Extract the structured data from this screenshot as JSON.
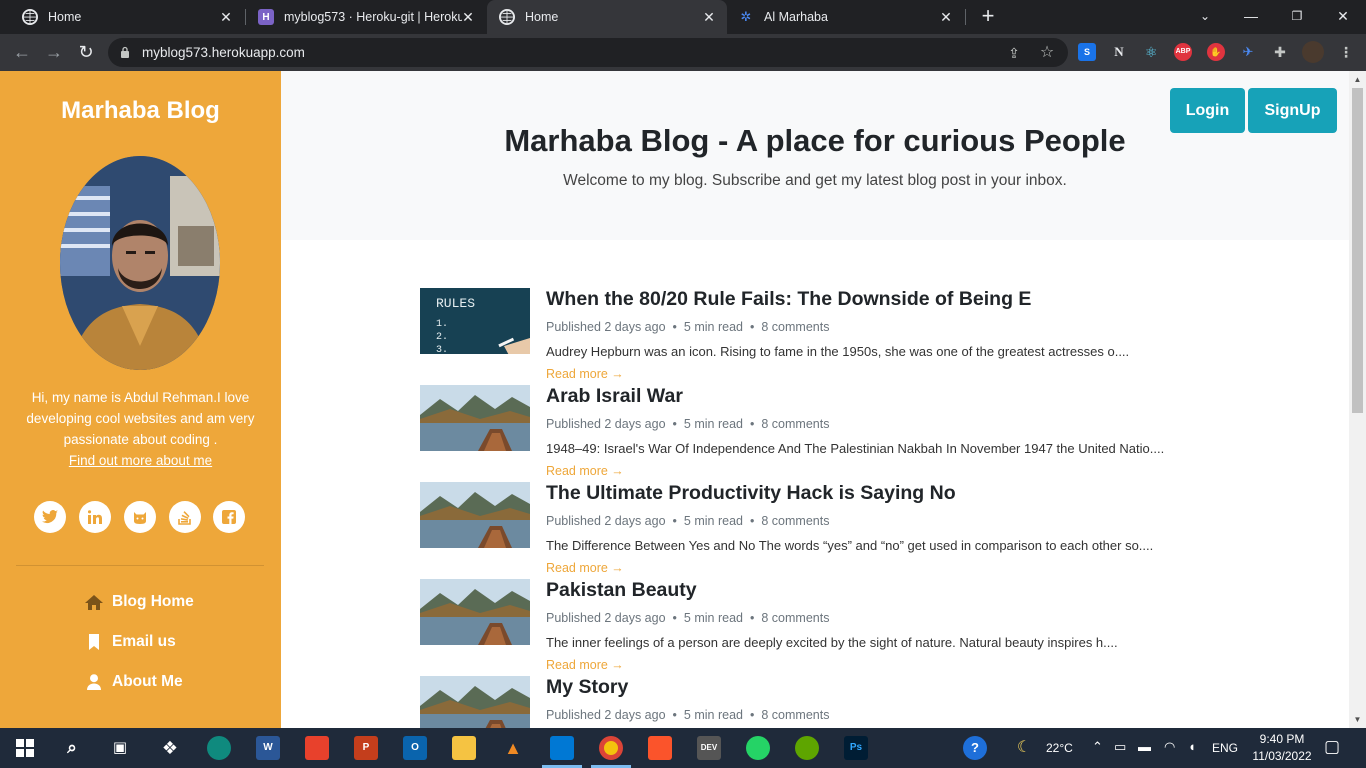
{
  "browser": {
    "tabs": [
      {
        "title": "Home"
      },
      {
        "title": "myblog573 · Heroku-git | Heroku"
      },
      {
        "title": "Home"
      },
      {
        "title": "Al Marhaba"
      }
    ],
    "url": "myblog573.herokuapp.com",
    "extensions": [
      "S",
      "N",
      "ABP"
    ]
  },
  "sidebar": {
    "brand": "Marhaba Blog",
    "intro": "Hi, my name is Abdul Rehman.I love developing cool websites and am very passionate about coding .",
    "find_more": "Find out more about me",
    "social_icons": [
      "twitter-icon",
      "linkedin-icon",
      "github-icon",
      "stackoverflow-icon",
      "facebook-icon"
    ],
    "nav": [
      {
        "label": "Blog Home",
        "icon": "home-icon"
      },
      {
        "label": "Email us",
        "icon": "bookmark-icon"
      },
      {
        "label": "About Me",
        "icon": "user-icon"
      }
    ]
  },
  "hero": {
    "title": "Marhaba Blog - A place for curious People",
    "subtitle": "Welcome to my blog. Subscribe and get my latest blog post in your inbox.",
    "login": "Login",
    "signup": "SignUp"
  },
  "posts": [
    {
      "title": "When the 80/20 Rule Fails: The Downside of Being E",
      "published": "Published 2 days ago",
      "read": "5 min read",
      "comments": "8 comments",
      "excerpt": "Audrey Hepburn was an icon. Rising to fame in the 1950s, she was one of the greatest actresses o....",
      "read_more": "Read more →",
      "thumb_text": "RULES"
    },
    {
      "title": "Arab Israil War",
      "published": "Published 2 days ago",
      "read": "5 min read",
      "comments": "8 comments",
      "excerpt": "1948–49: Israel's War Of Independence And The Palestinian Nakbah In November 1947 the United Natio....",
      "read_more": "Read more →"
    },
    {
      "title": "The Ultimate Productivity Hack is Saying No",
      "published": "Published 2 days ago",
      "read": "5 min read",
      "comments": "8 comments",
      "excerpt": "The Difference Between Yes and No The words “yes” and “no” get used in comparison to each other so....",
      "read_more": "Read more →"
    },
    {
      "title": "Pakistan Beauty",
      "published": "Published 2 days ago",
      "read": "5 min read",
      "comments": "8 comments",
      "excerpt": "The inner feelings of a person are deeply excited by the sight of nature. Natural beauty inspires h....",
      "read_more": "Read more →"
    },
    {
      "title": "My Story",
      "published": "Published 2 days ago",
      "read": "5 min read",
      "comments": "8 comments",
      "excerpt": "",
      "read_more": ""
    }
  ],
  "taskbar": {
    "weather": "22°C",
    "lang": "ENG",
    "time": "9:40 PM",
    "date": "11/03/2022",
    "apps": [
      "W",
      "P",
      "O",
      "DEV",
      "Ps"
    ]
  },
  "colors": {
    "accent": "#eea73a",
    "button": "#17a2b8",
    "chrome_dark": "#202124",
    "chrome_toolbar": "#35363a"
  }
}
